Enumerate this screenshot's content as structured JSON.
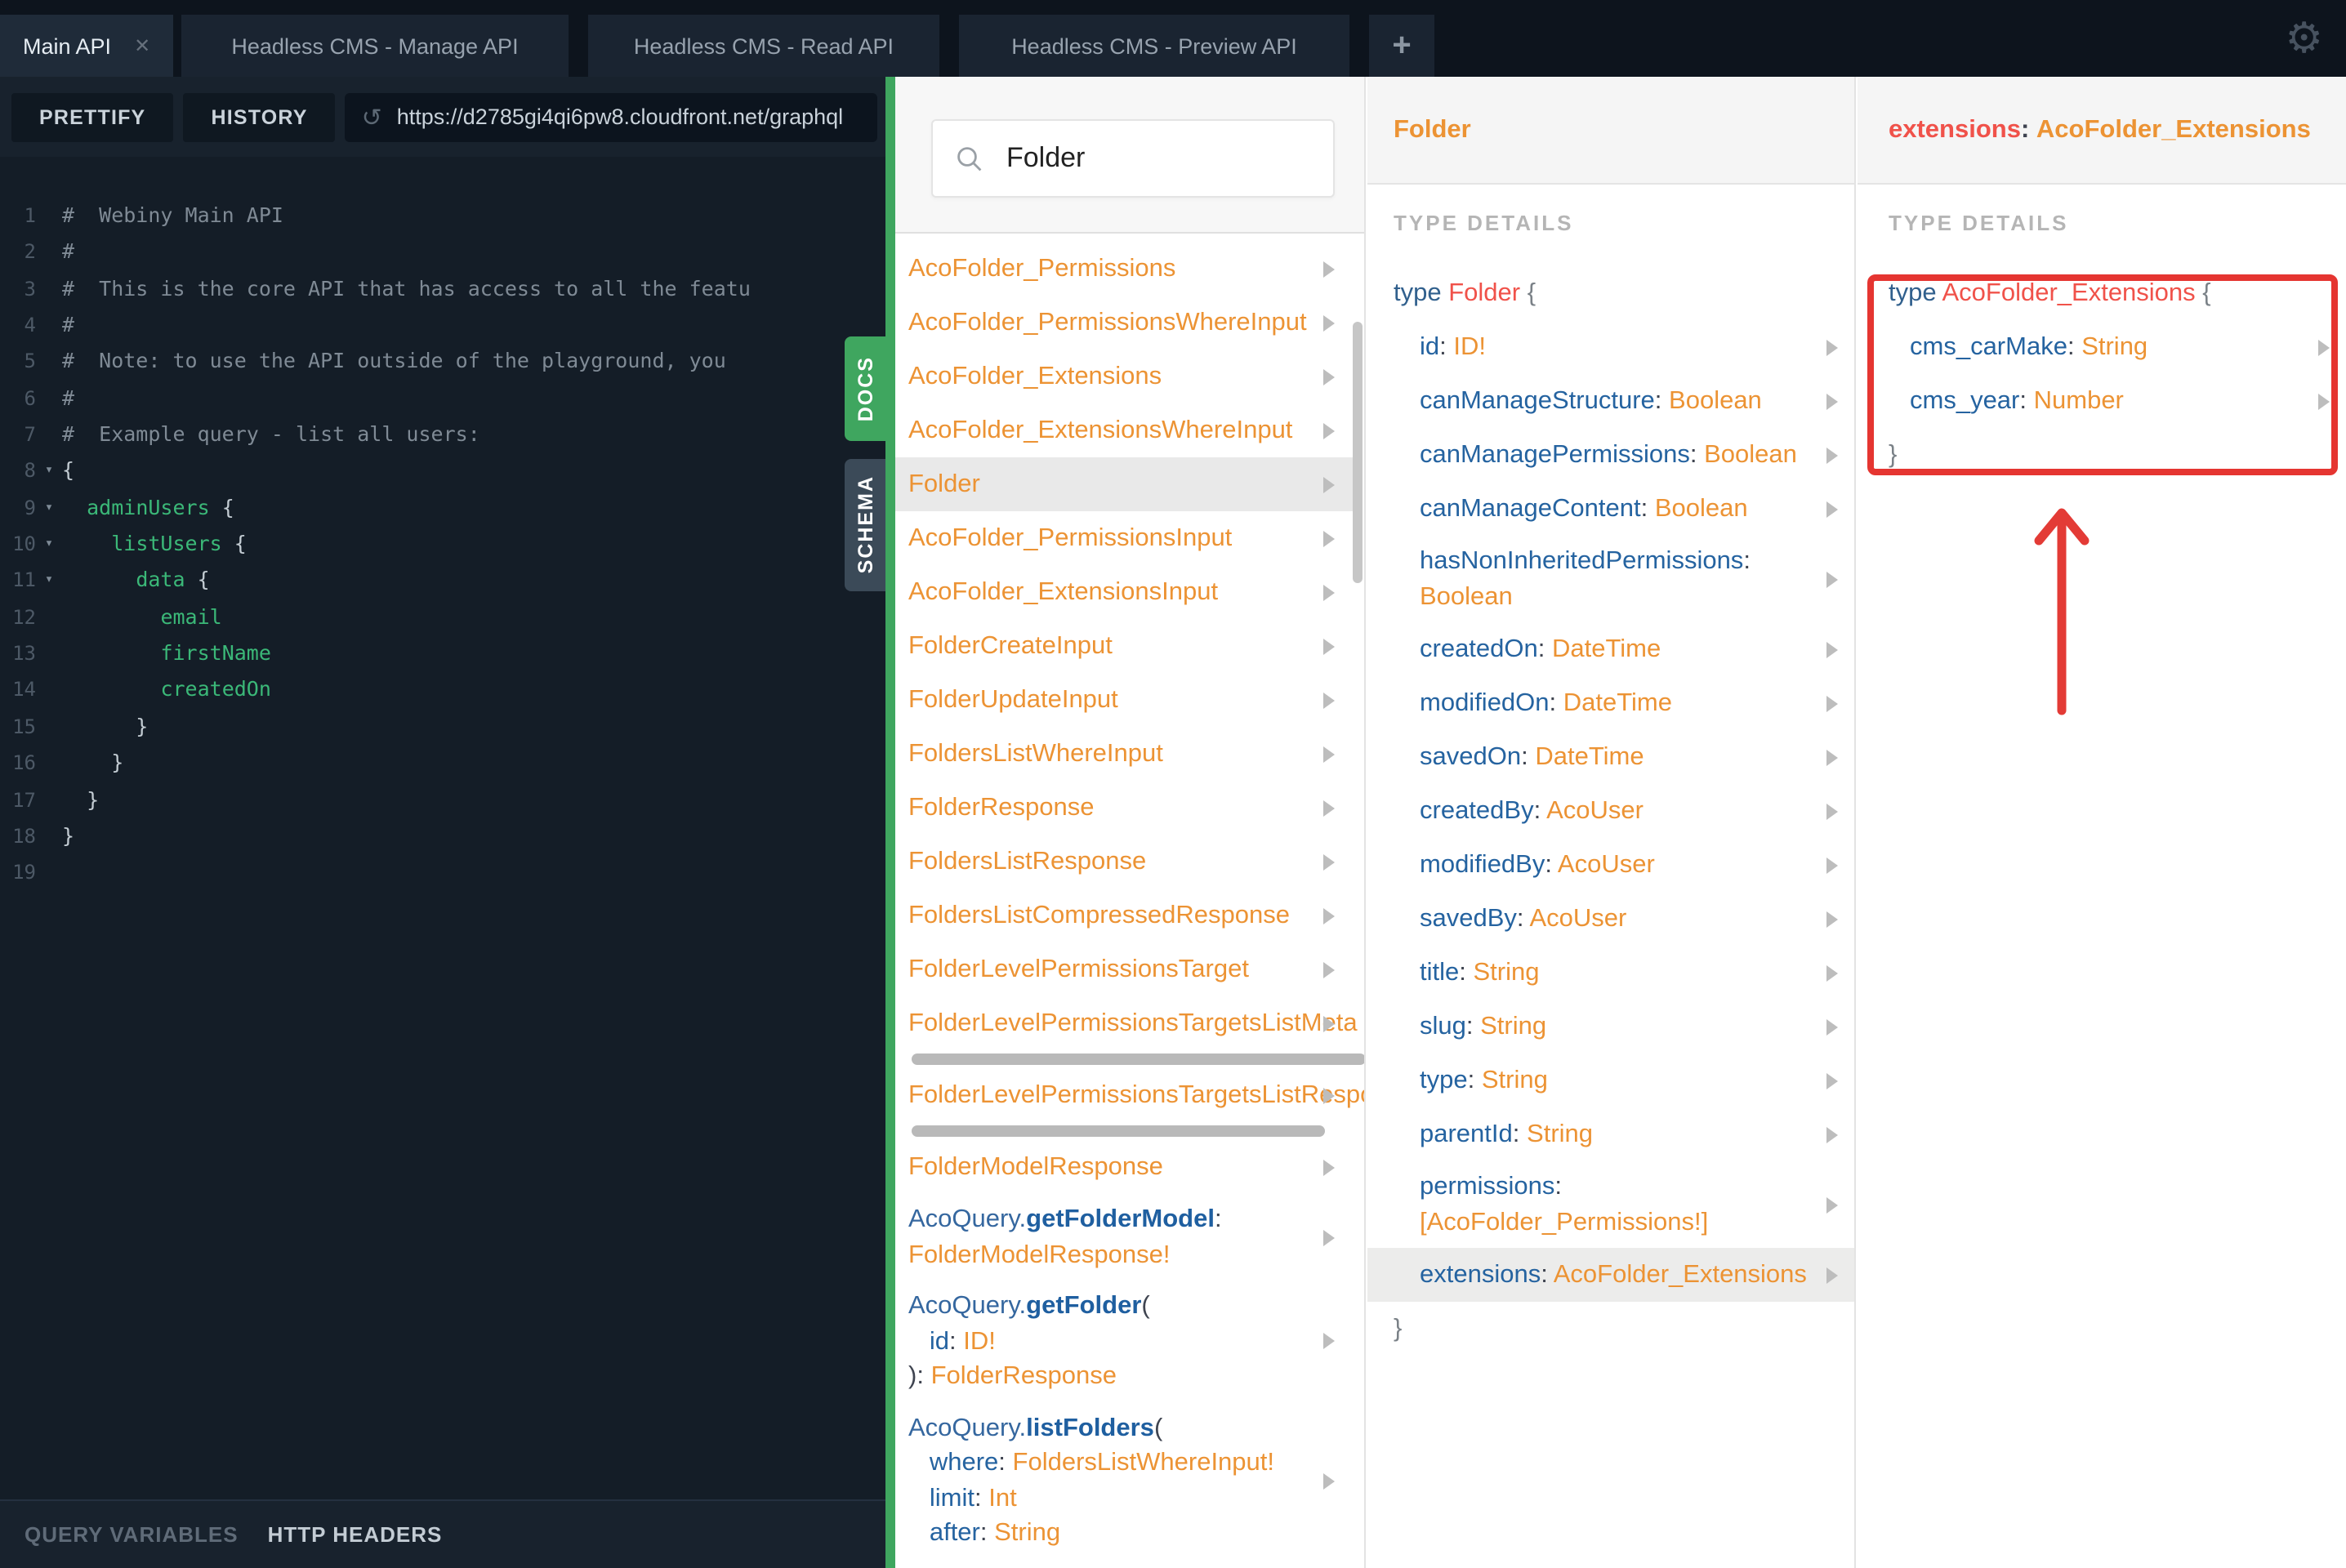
{
  "icons": {
    "gear": "⚙",
    "close": "✕",
    "add": "+",
    "reload": "↺",
    "fold": "▾"
  },
  "colors": {
    "accent_green": "#3fa65f",
    "orange": "#ec9334",
    "field_blue": "#2563a0",
    "type_red": "#f0524a",
    "keyword_blue": "#31608d",
    "annotation_red": "#e53531",
    "code_green": "#3bb878"
  },
  "tabs": {
    "items": [
      {
        "label": "Main API",
        "active": true,
        "closable": true
      },
      {
        "label": "Headless CMS - Manage API",
        "active": false
      },
      {
        "label": "Headless CMS - Read API",
        "active": false
      },
      {
        "label": "Headless CMS - Preview API",
        "active": false
      }
    ],
    "add_label": "+"
  },
  "toolbar": {
    "prettify": "PRETTIFY",
    "history": "HISTORY",
    "url": "https://d2785gi4qi6pw8.cloudfront.net/graphql"
  },
  "side_tabs": {
    "docs": "DOCS",
    "schema": "SCHEMA"
  },
  "footer": {
    "query_variables": "QUERY VARIABLES",
    "http_headers": "HTTP HEADERS"
  },
  "editor": {
    "lines": [
      {
        "n": "1",
        "fold": false,
        "segs": [
          {
            "t": "#  Webiny Main API",
            "c": "comment"
          }
        ]
      },
      {
        "n": "2",
        "fold": false,
        "segs": [
          {
            "t": "#",
            "c": "comment"
          }
        ]
      },
      {
        "n": "3",
        "fold": false,
        "segs": [
          {
            "t": "#  This is the core API that has access to all the featu",
            "c": "comment"
          }
        ]
      },
      {
        "n": "4",
        "fold": false,
        "segs": [
          {
            "t": "#",
            "c": "comment"
          }
        ]
      },
      {
        "n": "5",
        "fold": false,
        "segs": [
          {
            "t": "#  Note: to use the API outside of the playground, you",
            "c": "comment"
          }
        ]
      },
      {
        "n": "6",
        "fold": false,
        "segs": [
          {
            "t": "#",
            "c": "comment"
          }
        ]
      },
      {
        "n": "7",
        "fold": false,
        "segs": [
          {
            "t": "#  Example query - list all users:",
            "c": "comment"
          }
        ]
      },
      {
        "n": "8",
        "fold": true,
        "segs": [
          {
            "t": "{",
            "c": "punc"
          }
        ]
      },
      {
        "n": "9",
        "fold": true,
        "segs": [
          {
            "t": "  ",
            "c": "plain"
          },
          {
            "t": "adminUsers",
            "c": "green"
          },
          {
            "t": " {",
            "c": "punc"
          }
        ]
      },
      {
        "n": "10",
        "fold": true,
        "segs": [
          {
            "t": "    ",
            "c": "plain"
          },
          {
            "t": "listUsers",
            "c": "green"
          },
          {
            "t": " {",
            "c": "punc"
          }
        ]
      },
      {
        "n": "11",
        "fold": true,
        "segs": [
          {
            "t": "      ",
            "c": "plain"
          },
          {
            "t": "data",
            "c": "green"
          },
          {
            "t": " {",
            "c": "punc"
          }
        ]
      },
      {
        "n": "12",
        "fold": false,
        "segs": [
          {
            "t": "        ",
            "c": "plain"
          },
          {
            "t": "email",
            "c": "green"
          }
        ]
      },
      {
        "n": "13",
        "fold": false,
        "segs": [
          {
            "t": "        ",
            "c": "plain"
          },
          {
            "t": "firstName",
            "c": "green"
          }
        ]
      },
      {
        "n": "14",
        "fold": false,
        "segs": [
          {
            "t": "        ",
            "c": "plain"
          },
          {
            "t": "createdOn",
            "c": "green"
          }
        ]
      },
      {
        "n": "15",
        "fold": false,
        "segs": [
          {
            "t": "      }",
            "c": "punc"
          }
        ]
      },
      {
        "n": "16",
        "fold": false,
        "segs": [
          {
            "t": "    }",
            "c": "punc"
          }
        ]
      },
      {
        "n": "17",
        "fold": false,
        "segs": [
          {
            "t": "  }",
            "c": "punc"
          }
        ]
      },
      {
        "n": "18",
        "fold": false,
        "segs": [
          {
            "t": "}",
            "c": "punc"
          }
        ]
      },
      {
        "n": "19",
        "fold": false,
        "segs": []
      }
    ]
  },
  "docs_panel": {
    "search_value": "Folder",
    "items": [
      {
        "kind": "simple",
        "text": "AcoFolder_Permissions"
      },
      {
        "kind": "simple",
        "text": "AcoFolder_PermissionsWhereInput"
      },
      {
        "kind": "simple",
        "text": "AcoFolder_Extensions"
      },
      {
        "kind": "simple",
        "text": "AcoFolder_ExtensionsWhereInput"
      },
      {
        "kind": "simple",
        "text": "Folder",
        "highlight": true
      },
      {
        "kind": "simple",
        "text": "AcoFolder_PermissionsInput"
      },
      {
        "kind": "simple",
        "text": "AcoFolder_ExtensionsInput"
      },
      {
        "kind": "simple",
        "text": "FolderCreateInput"
      },
      {
        "kind": "simple",
        "text": "FolderUpdateInput"
      },
      {
        "kind": "simple",
        "text": "FoldersListWhereInput"
      },
      {
        "kind": "simple",
        "text": "FolderResponse"
      },
      {
        "kind": "simple",
        "text": "FoldersListResponse"
      },
      {
        "kind": "simple",
        "text": "FoldersListCompressedResponse"
      },
      {
        "kind": "simple",
        "text": "FolderLevelPermissionsTarget"
      },
      {
        "kind": "simple",
        "text": "FolderLevelPermissionsTargetsListMeta",
        "overflow": true
      },
      {
        "kind": "hscroll",
        "width": "97%"
      },
      {
        "kind": "simple",
        "text": "FolderLevelPermissionsTargetsListRespo",
        "overflow": true
      },
      {
        "kind": "hscroll",
        "width": "88%"
      },
      {
        "kind": "simple",
        "text": "FolderModelResponse"
      },
      {
        "kind": "complex",
        "lines": [
          [
            {
              "t": "AcoQuery.",
              "c": "ns"
            },
            {
              "t": "getFolderModel",
              "c": "method"
            },
            {
              "t": ":",
              "c": "dark"
            }
          ],
          [
            {
              "t": "FolderModelResponse!",
              "c": "orange"
            }
          ]
        ]
      },
      {
        "kind": "complex",
        "lines": [
          [
            {
              "t": "AcoQuery.",
              "c": "ns"
            },
            {
              "t": "getFolder",
              "c": "method"
            },
            {
              "t": "(",
              "c": "dark"
            }
          ],
          [
            {
              "t": "   ",
              "c": "plain"
            },
            {
              "t": "id",
              "c": "field"
            },
            {
              "t": ": ",
              "c": "dark"
            },
            {
              "t": "ID!",
              "c": "orange"
            }
          ],
          [
            {
              "t": "): ",
              "c": "dark"
            },
            {
              "t": "FolderResponse",
              "c": "orange"
            }
          ]
        ]
      },
      {
        "kind": "complex",
        "lines": [
          [
            {
              "t": "AcoQuery.",
              "c": "ns"
            },
            {
              "t": "listFolders",
              "c": "method"
            },
            {
              "t": "(",
              "c": "dark"
            }
          ],
          [
            {
              "t": "   ",
              "c": "plain"
            },
            {
              "t": "where",
              "c": "field"
            },
            {
              "t": ": ",
              "c": "dark"
            },
            {
              "t": "FoldersListWhereInput!",
              "c": "orange"
            }
          ],
          [
            {
              "t": "   ",
              "c": "plain"
            },
            {
              "t": "limit",
              "c": "field"
            },
            {
              "t": ": ",
              "c": "dark"
            },
            {
              "t": "Int",
              "c": "orange"
            }
          ],
          [
            {
              "t": "   ",
              "c": "plain"
            },
            {
              "t": "after",
              "c": "field"
            },
            {
              "t": ": ",
              "c": "dark"
            },
            {
              "t": "String",
              "c": "orange"
            }
          ]
        ]
      }
    ]
  },
  "folder_panel": {
    "header": [
      {
        "t": "Folder",
        "c": "orange"
      }
    ],
    "section_label": "TYPE DETAILS",
    "decl": [
      {
        "t": "type ",
        "c": "kw"
      },
      {
        "t": "Folder ",
        "c": "typered"
      },
      {
        "t": "{",
        "c": "brace"
      }
    ],
    "fields": [
      {
        "name": "id",
        "type": "ID!"
      },
      {
        "name": "canManageStructure",
        "type": "Boolean"
      },
      {
        "name": "canManagePermissions",
        "type": "Boolean"
      },
      {
        "name": "canManageContent",
        "type": "Boolean"
      },
      {
        "name": "hasNonInheritedPermissions",
        "type": "Boolean",
        "two_line": true
      },
      {
        "name": "createdOn",
        "type": "DateTime"
      },
      {
        "name": "modifiedOn",
        "type": "DateTime"
      },
      {
        "name": "savedOn",
        "type": "DateTime"
      },
      {
        "name": "createdBy",
        "type": "AcoUser"
      },
      {
        "name": "modifiedBy",
        "type": "AcoUser"
      },
      {
        "name": "savedBy",
        "type": "AcoUser"
      },
      {
        "name": "title",
        "type": "String"
      },
      {
        "name": "slug",
        "type": "String"
      },
      {
        "name": "type",
        "type": "String"
      },
      {
        "name": "parentId",
        "type": "String"
      },
      {
        "name": "permissions",
        "type": "[AcoFolder_Permissions!]",
        "two_line": true
      },
      {
        "name": "extensions",
        "type": "AcoFolder_Extensions",
        "highlight": true
      }
    ],
    "close_brace": "}"
  },
  "extensions_panel": {
    "header": [
      {
        "t": "extensions",
        "c": "typered"
      },
      {
        "t": ": ",
        "c": "dark"
      },
      {
        "t": "AcoFolder_Extensions",
        "c": "orange"
      }
    ],
    "section_label": "TYPE DETAILS",
    "decl": [
      {
        "t": "type ",
        "c": "kw"
      },
      {
        "t": "AcoFolder_Extensions ",
        "c": "typered"
      },
      {
        "t": "{",
        "c": "brace"
      }
    ],
    "fields": [
      {
        "name": "cms_carMake",
        "type": "String"
      },
      {
        "name": "cms_year",
        "type": "Number"
      }
    ],
    "close_brace": "}"
  }
}
